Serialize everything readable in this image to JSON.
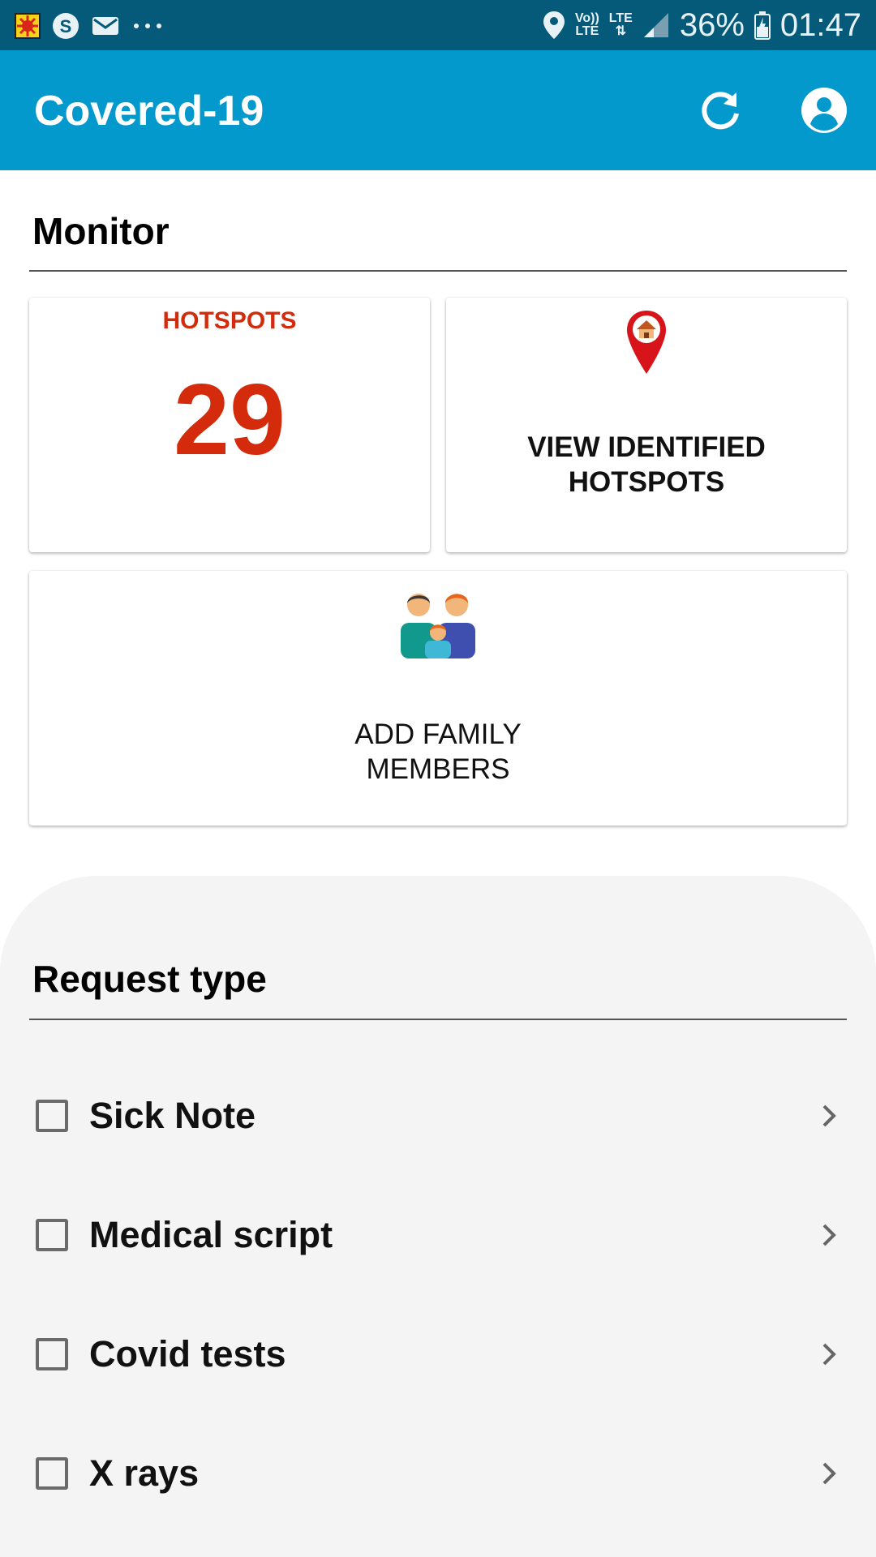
{
  "status_bar": {
    "network_top": "Vo))",
    "network_bottom": "LTE",
    "lte_label": "LTE",
    "battery": "36%",
    "time": "01:47"
  },
  "app_bar": {
    "title": "Covered-19",
    "icons": [
      "refresh-icon",
      "account-circle-icon"
    ],
    "color": "#0399cc"
  },
  "monitor": {
    "title": "Monitor",
    "hotspots_card": {
      "label": "HOTSPOTS",
      "count": "29",
      "color": "#d32b0b"
    },
    "view_hotspots_card": {
      "icon": "map-pin-home-icon",
      "line1": "VIEW IDENTIFIED",
      "line2": "HOTSPOTS"
    },
    "family_card": {
      "icon": "family-icon",
      "line1": "ADD FAMILY",
      "line2": "MEMBERS"
    }
  },
  "request": {
    "title": "Request type",
    "items": [
      {
        "label": "Sick Note",
        "checked": false
      },
      {
        "label": "Medical script",
        "checked": false
      },
      {
        "label": "Covid tests",
        "checked": false
      },
      {
        "label": "X rays",
        "checked": false
      }
    ]
  }
}
